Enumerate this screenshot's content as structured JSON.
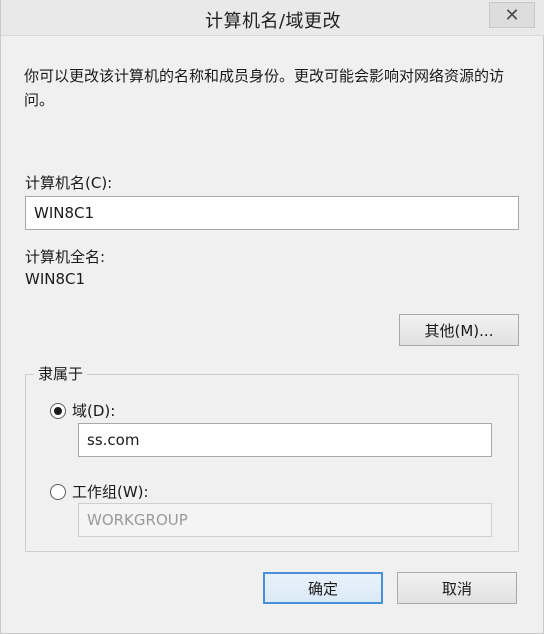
{
  "window": {
    "title": "计算机名/域更改",
    "close_glyph": "✕"
  },
  "description": "你可以更改该计算机的名称和成员身份。更改可能会影响对网络资源的访问。",
  "computer_name": {
    "label": "计算机名(C):",
    "value": "WIN8C1"
  },
  "full_name": {
    "label": "计算机全名:",
    "value": "WIN8C1"
  },
  "more_button": "其他(M)...",
  "member_of": {
    "legend": "隶属于",
    "domain": {
      "label": "域(D):",
      "value": "ss.com",
      "selected": true
    },
    "workgroup": {
      "label": "工作组(W):",
      "value": "WORKGROUP",
      "selected": false
    }
  },
  "buttons": {
    "ok": "确定",
    "cancel": "取消"
  }
}
